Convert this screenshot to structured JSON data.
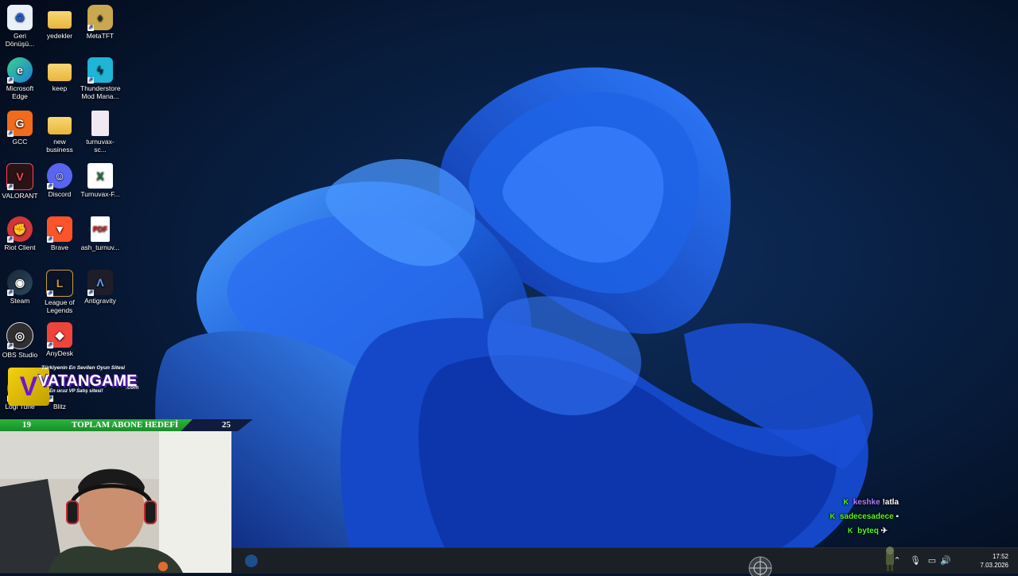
{
  "desktop": {
    "icons": [
      {
        "label": "Geri Dönüşü...",
        "icon": "recycle-bin-icon"
      },
      {
        "label": "yedekler",
        "icon": "folder-icon"
      },
      {
        "label": "MetaTFT",
        "icon": "metatft-icon"
      },
      {
        "label": "Microsoft Edge",
        "icon": "edge-icon"
      },
      {
        "label": "keep",
        "icon": "folder-icon"
      },
      {
        "label": "Thunderstore Mod Mana...",
        "icon": "thunderstore-icon"
      },
      {
        "label": "GCC",
        "icon": "gcc-icon"
      },
      {
        "label": "new business",
        "icon": "folder-icon"
      },
      {
        "label": "turnuvax-sc...",
        "icon": "document-icon"
      },
      {
        "label": "VALORANT",
        "icon": "valorant-icon"
      },
      {
        "label": "Discord",
        "icon": "discord-icon"
      },
      {
        "label": "Turnuvax-F...",
        "icon": "excel-icon"
      },
      {
        "label": "Riot Client",
        "icon": "riot-client-icon"
      },
      {
        "label": "Brave",
        "icon": "brave-icon"
      },
      {
        "label": "ash_turnuv...",
        "icon": "pdf-icon"
      },
      {
        "label": "Steam",
        "icon": "steam-icon"
      },
      {
        "label": "League of Legends",
        "icon": "league-of-legends-icon"
      },
      {
        "label": "Antigravity",
        "icon": "antigravity-icon"
      },
      {
        "label": "OBS Studio",
        "icon": "obs-icon"
      },
      {
        "label": "AnyDesk",
        "icon": "anydesk-icon"
      },
      {
        "label": "Logi Tune",
        "icon": "logi-tune-icon"
      },
      {
        "label": "Blitz",
        "icon": "blitz-icon"
      }
    ]
  },
  "promo": {
    "logo_letter": "V",
    "brand": "VATANGAME",
    "tagline_top": "Türkiyenin En Sevilen Oyun Sitesi",
    "tagline_bottom": "En ucuz VP Satış sitesi!",
    "domain_suffix": ".com"
  },
  "subscriber_goal": {
    "current": "19",
    "title": "TOPLAM ABONE HEDEFİ",
    "target": "25",
    "progress_fraction": 0.76
  },
  "chat": [
    {
      "user": "keshke",
      "text": "!atla",
      "color": "#b07cff"
    },
    {
      "user": "sadecesadece",
      "text": "",
      "color": "#53fc18"
    },
    {
      "user": "byteq",
      "text": "",
      "color": "#53fc18"
    }
  ],
  "taskbar": {
    "pinned": [
      {
        "icon": "steam-icon"
      }
    ],
    "tray_icons": [
      "chevron-up-icon",
      "microphone-icon",
      "display-icon",
      "speaker-icon"
    ],
    "time": "17:52",
    "date": "7.03.2026"
  },
  "colors": {
    "wallpaper_bg": "#06142b",
    "bloom_blue": "#1b5dd8",
    "goal_green": "#2bb53b",
    "taskbar": "#1b1f26"
  }
}
